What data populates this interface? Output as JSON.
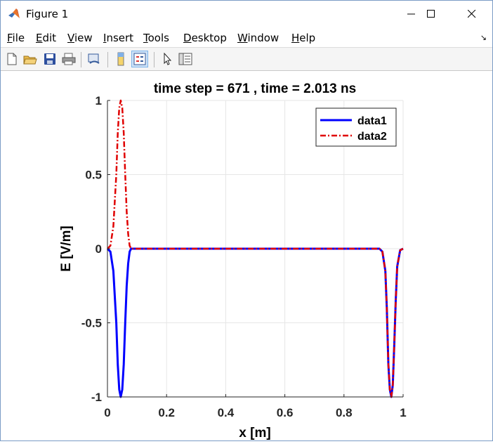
{
  "window": {
    "title": "Figure 1",
    "controls": {
      "minimize": "minimize",
      "maximize": "maximize",
      "close": "close"
    }
  },
  "menu": {
    "items": [
      {
        "label": "File",
        "u": "F",
        "rest": "ile"
      },
      {
        "label": "Edit",
        "u": "E",
        "rest": "dit"
      },
      {
        "label": "View",
        "u": "V",
        "rest": "iew"
      },
      {
        "label": "Insert",
        "u": "I",
        "rest": "nsert"
      },
      {
        "label": "Tools",
        "u": "T",
        "rest": "ools"
      },
      {
        "label": "Desktop",
        "u": "D",
        "rest": "esktop"
      },
      {
        "label": "Window",
        "u": "W",
        "rest": "indow"
      },
      {
        "label": "Help",
        "u": "H",
        "rest": "elp"
      }
    ]
  },
  "toolbar": {
    "buttons": [
      "new-figure-icon",
      "open-file-icon",
      "save-icon",
      "print-icon",
      "link-plot-icon",
      "colorbar-icon",
      "legend-icon",
      "pointer-icon",
      "property-inspector-icon"
    ]
  },
  "chart_data": {
    "type": "line",
    "title": "time step = 671 , time = 2.013 ns",
    "xlabel": "x [m]",
    "ylabel": "E [V/m]",
    "xlim": [
      0,
      1
    ],
    "ylim": [
      -1,
      1
    ],
    "xticks": [
      "0",
      "0.2",
      "0.4",
      "0.6",
      "0.8",
      "1"
    ],
    "yticks": [
      "1",
      "0.5",
      "0",
      "-0.5",
      "-1"
    ],
    "grid": true,
    "legend_position": "top-right",
    "series": [
      {
        "name": "data1",
        "color": "#0000ff",
        "style": "solid",
        "x": [
          0,
          0.01,
          0.02,
          0.03,
          0.035,
          0.04,
          0.045,
          0.05,
          0.055,
          0.06,
          0.065,
          0.07,
          0.075,
          0.08,
          0.1,
          0.3,
          0.5,
          0.7,
          0.9,
          0.92,
          0.93,
          0.94,
          0.945,
          0.95,
          0.955,
          0.96,
          0.965,
          0.97,
          0.975,
          0.98,
          0.99,
          1.0
        ],
        "y": [
          0,
          -0.02,
          -0.15,
          -0.5,
          -0.78,
          -0.95,
          -1.0,
          -0.95,
          -0.78,
          -0.5,
          -0.25,
          -0.1,
          -0.02,
          0,
          0,
          0,
          0,
          0,
          0,
          0,
          -0.02,
          -0.15,
          -0.4,
          -0.78,
          -0.95,
          -1.0,
          -0.92,
          -0.65,
          -0.35,
          -0.12,
          -0.01,
          0
        ]
      },
      {
        "name": "data2",
        "color": "#e00000",
        "style": "dash-dot",
        "x": [
          0,
          0.01,
          0.02,
          0.03,
          0.035,
          0.04,
          0.045,
          0.05,
          0.055,
          0.06,
          0.065,
          0.07,
          0.075,
          0.08,
          0.1,
          0.3,
          0.5,
          0.7,
          0.9,
          0.92,
          0.93,
          0.94,
          0.945,
          0.95,
          0.955,
          0.96,
          0.965,
          0.97,
          0.975,
          0.98,
          0.99,
          1.0
        ],
        "y": [
          0,
          0.02,
          0.15,
          0.5,
          0.78,
          0.95,
          1.0,
          0.95,
          0.78,
          0.5,
          0.25,
          0.1,
          0.02,
          0,
          0,
          0,
          0,
          0,
          0,
          0,
          -0.02,
          -0.15,
          -0.4,
          -0.78,
          -0.95,
          -1.0,
          -0.92,
          -0.65,
          -0.35,
          -0.12,
          -0.01,
          0
        ]
      }
    ]
  }
}
